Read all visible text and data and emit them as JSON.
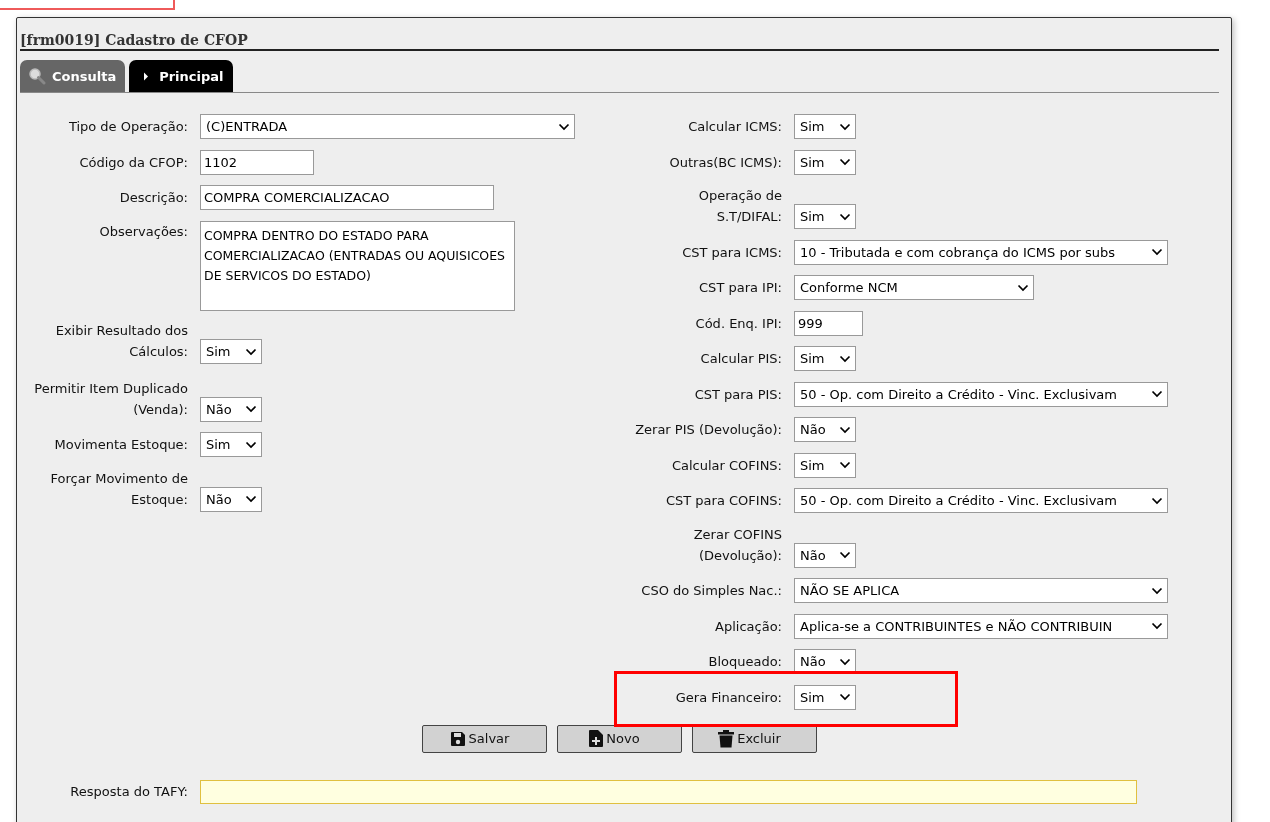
{
  "form": {
    "title": "[frm0019] Cadastro de CFOP"
  },
  "tabs": [
    {
      "label": "Consulta",
      "kind": "search",
      "selected": false
    },
    {
      "label": "Principal",
      "kind": "arrow",
      "selected": true
    }
  ],
  "left_fields": [
    {
      "label": "Tipo de Operação:",
      "kind": "select",
      "value": "(C)ENTRADA"
    },
    {
      "label": "Código da CFOP:",
      "kind": "text",
      "value": "1102"
    },
    {
      "label": "Descrição:",
      "kind": "text",
      "value": "COMPRA COMERCIALIZACAO"
    },
    {
      "label": "Observações:",
      "kind": "textarea",
      "value": "COMPRA DENTRO DO ESTADO PARA COMERCIALIZACAO (ENTRADAS OU AQUISICOES DE SERVICOS DO ESTADO)"
    },
    {
      "label": "Exibir Resultado dos Cálculos:",
      "kind": "yesno",
      "value": "Sim"
    },
    {
      "label": "Permitir Item Duplicado (Venda):",
      "kind": "yesno",
      "value": "Não"
    },
    {
      "label": "Movimenta Estoque:",
      "kind": "yesno",
      "value": "Sim"
    },
    {
      "label": "Forçar Movimento de Estoque:",
      "kind": "yesno",
      "value": "Não"
    }
  ],
  "right_fields": [
    {
      "label": "Calcular ICMS:",
      "kind": "yesno",
      "value": "Sim"
    },
    {
      "label": "Outras(BC ICMS):",
      "kind": "yesno",
      "value": "Sim"
    },
    {
      "label": "Operação de S.T/DIFAL:",
      "kind": "yesno",
      "value": "Sim"
    },
    {
      "label": "CST para ICMS:",
      "kind": "select",
      "value": "10 - Tributada e com cobrança do ICMS por subs"
    },
    {
      "label": "CST para IPI:",
      "kind": "select",
      "value": "Conforme NCM"
    },
    {
      "label": "Cód. Enq. IPI:",
      "kind": "text",
      "value": "999"
    },
    {
      "label": "Calcular PIS:",
      "kind": "yesno",
      "value": "Sim"
    },
    {
      "label": "CST para PIS:",
      "kind": "select",
      "value": "50 - Op. com Direito a Crédito - Vinc. Exclusivam"
    },
    {
      "label": "Zerar PIS (Devolução):",
      "kind": "yesno",
      "value": "Não"
    },
    {
      "label": "Calcular COFINS:",
      "kind": "yesno",
      "value": "Sim"
    },
    {
      "label": "CST para COFINS:",
      "kind": "select",
      "value": "50 - Op. com Direito a Crédito - Vinc. Exclusivam"
    },
    {
      "label": "Zerar COFINS (Devolução):",
      "kind": "yesno",
      "value": "Não"
    },
    {
      "label": "CSO do Simples Nac.:",
      "kind": "select",
      "value": "NÃO SE APLICA"
    },
    {
      "label": "Aplicação:",
      "kind": "select",
      "value": "Aplica-se a CONTRIBUINTES e NÃO CONTRIBUIN"
    },
    {
      "label": "Bloqueado:",
      "kind": "yesno",
      "value": "Não"
    },
    {
      "label": "Gera Financeiro:",
      "kind": "yesno",
      "value": "Sim",
      "highlighted": true
    }
  ],
  "buttons": [
    {
      "label": "Salvar",
      "kind": "save"
    },
    {
      "label": "Novo",
      "kind": "new"
    },
    {
      "label": "Excluir",
      "kind": "delete"
    }
  ],
  "response": {
    "label": "Resposta do TAFY:"
  }
}
